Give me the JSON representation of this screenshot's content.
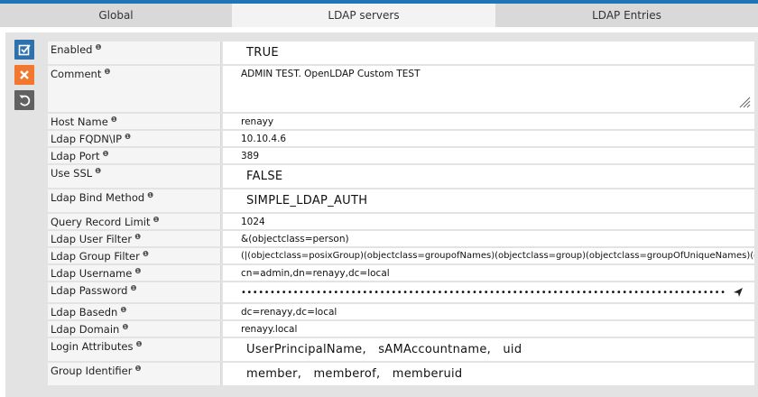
{
  "tabs": [
    "Global",
    "LDAP servers",
    "LDAP Entries"
  ],
  "side_actions": [
    {
      "name": "save-button",
      "icon": "checkbox-check-icon"
    },
    {
      "name": "cancel-button",
      "icon": "close-icon"
    },
    {
      "name": "reset-button",
      "icon": "undo-icon"
    }
  ],
  "form": {
    "enabled": {
      "label": "Enabled",
      "value": "TRUE"
    },
    "comment": {
      "label": "Comment",
      "value": "ADMIN TEST. OpenLDAP Custom TEST"
    },
    "host_name": {
      "label": "Host Name",
      "value": "renayy"
    },
    "fqdn": {
      "label": "Ldap FQDN\\IP",
      "value": "10.10.4.6"
    },
    "port": {
      "label": "Ldap Port",
      "value": "389"
    },
    "use_ssl": {
      "label": "Use SSL",
      "value": "FALSE"
    },
    "bind_method": {
      "label": "Ldap Bind Method",
      "value": "SIMPLE_LDAP_AUTH"
    },
    "query_limit": {
      "label": "Query Record Limit",
      "value": "1024"
    },
    "user_filter": {
      "label": "Ldap User Filter",
      "value": "&(objectclass=person)"
    },
    "group_filter": {
      "label": "Ldap Group Filter",
      "value": "(|(objectclass=posixGroup)(objectclass=groupofNames)(objectclass=group)(objectclass=groupOfUniqueNames)(ol"
    },
    "username": {
      "label": "Ldap Username",
      "value": "cn=admin,dn=renayy,dc=local"
    },
    "password": {
      "label": "Ldap Password",
      "value": "••••••••••••••••••••••••••••••••••••••••••••••••••••••••••••••••••••••••••••••••••••"
    },
    "basedn": {
      "label": "Ldap Basedn",
      "value": "dc=renayy,dc=local"
    },
    "domain": {
      "label": "Ldap Domain",
      "value": "renayy.local"
    },
    "login_attrs": {
      "label": "Login Attributes",
      "value": "UserPrincipalName,   sAMAccountname,   uid"
    },
    "group_identifier": {
      "label": "Group Identifier",
      "value": "member,   memberof,   memberuid"
    }
  },
  "info_symbol": "❶"
}
